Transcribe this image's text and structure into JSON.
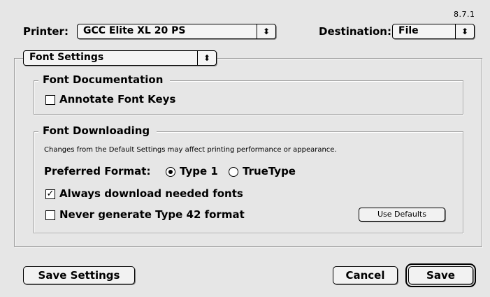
{
  "version": "8.7.1",
  "printer": {
    "label": "Printer:",
    "value": "GCC Elite XL 20 PS"
  },
  "destination": {
    "label": "Destination:",
    "value": "File"
  },
  "panel_popup": {
    "value": "Font Settings"
  },
  "font_documentation": {
    "title": "Font Documentation",
    "annotate": {
      "label": "Annotate Font Keys",
      "checked": false
    }
  },
  "font_downloading": {
    "title": "Font Downloading",
    "note": "Changes from the Default Settings may affect printing performance or appearance.",
    "preferred_format": {
      "label": "Preferred Format:",
      "options": [
        {
          "label": "Type 1",
          "selected": true
        },
        {
          "label": "TrueType",
          "selected": false
        }
      ]
    },
    "always_download": {
      "label": "Always download needed fonts",
      "checked": true
    },
    "never_type42": {
      "label": "Never generate Type 42 format",
      "checked": false
    },
    "use_defaults_label": "Use Defaults"
  },
  "buttons": {
    "save_settings": "Save Settings",
    "cancel": "Cancel",
    "save": "Save"
  },
  "icons": {
    "popup_arrows": "⬍",
    "checkmark": "✓"
  }
}
